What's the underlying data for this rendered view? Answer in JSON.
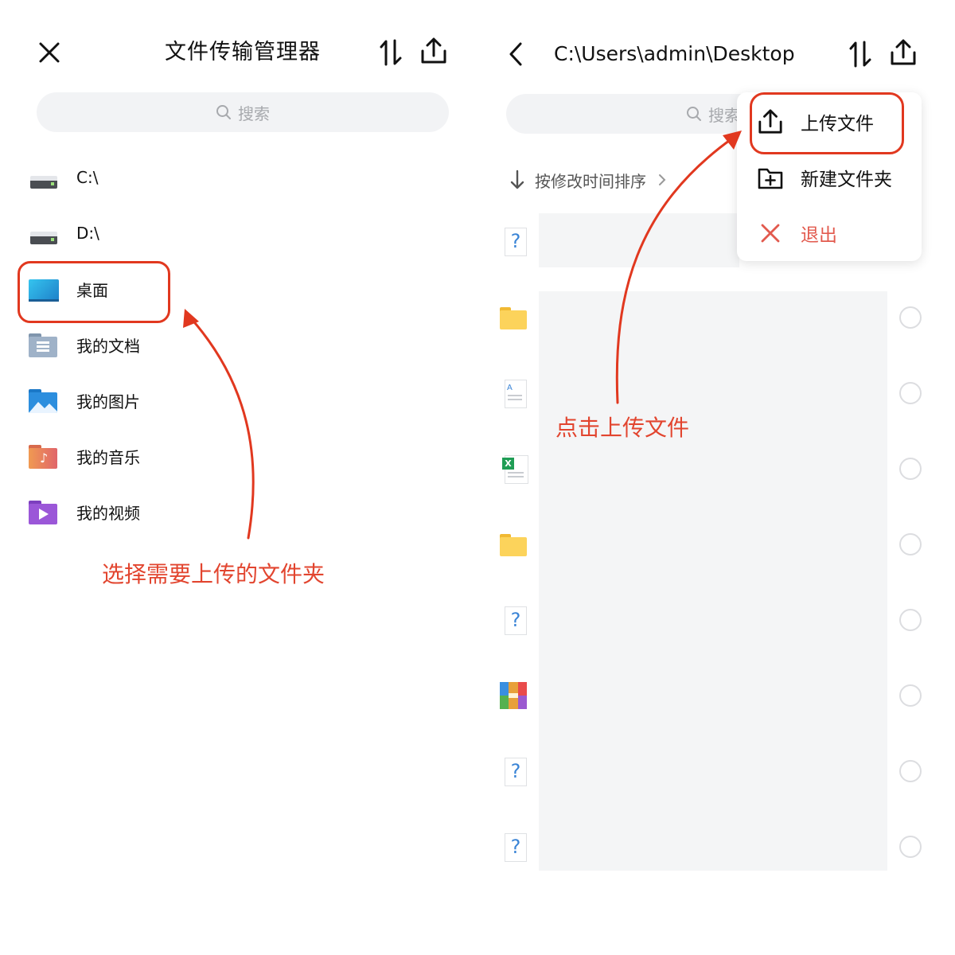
{
  "left_panel": {
    "title": "文件传输管理器",
    "search_placeholder": "搜索",
    "items": [
      {
        "label": "C:\\",
        "icon": "drive-icon"
      },
      {
        "label": "D:\\",
        "icon": "drive-icon"
      },
      {
        "label": "桌面",
        "icon": "desktop-icon"
      },
      {
        "label": "我的文档",
        "icon": "documents-icon"
      },
      {
        "label": "我的图片",
        "icon": "pictures-icon"
      },
      {
        "label": "我的音乐",
        "icon": "music-icon"
      },
      {
        "label": "我的视频",
        "icon": "videos-icon"
      }
    ],
    "annotation": "选择需要上传的文件夹"
  },
  "right_panel": {
    "path": "C:\\Users\\admin\\Desktop",
    "search_placeholder": "搜索",
    "sort_label": "按修改时间排序",
    "files": [
      {
        "icon": "unknown-file-icon"
      },
      {
        "icon": "folder-icon"
      },
      {
        "icon": "text-document-icon"
      },
      {
        "icon": "excel-file-icon"
      },
      {
        "icon": "folder-icon"
      },
      {
        "icon": "unknown-file-icon"
      },
      {
        "icon": "archive-icon"
      },
      {
        "icon": "unknown-file-icon"
      },
      {
        "icon": "unknown-file-icon"
      }
    ],
    "menu": {
      "upload_file": "上传文件",
      "new_folder": "新建文件夹",
      "exit": "退出"
    },
    "annotation": "点击上传文件"
  },
  "colors": {
    "annotation_red": "#e2452f",
    "search_bg": "#f2f3f5",
    "exit_red": "#e25a4e"
  }
}
